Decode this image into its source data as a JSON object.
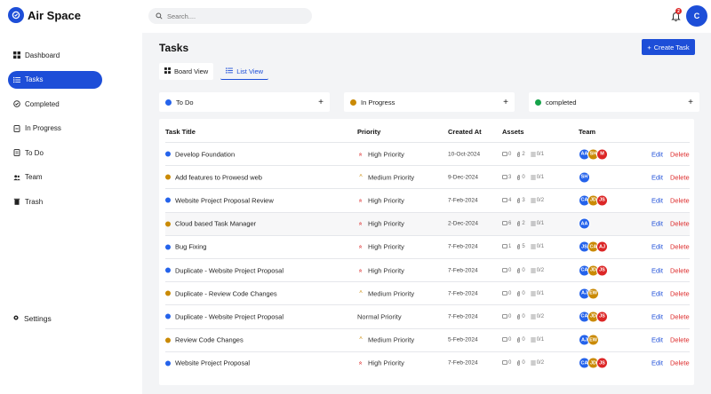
{
  "app": {
    "name": "Air Space"
  },
  "sidebar": {
    "items": [
      {
        "label": "Dashboard",
        "icon": "dashboard-icon",
        "active": false
      },
      {
        "label": "Tasks",
        "icon": "tasks-icon",
        "active": true
      },
      {
        "label": "Completed",
        "icon": "check-circle-icon",
        "active": false
      },
      {
        "label": "In Progress",
        "icon": "in-progress-icon",
        "active": false
      },
      {
        "label": "To Do",
        "icon": "todo-icon",
        "active": false
      },
      {
        "label": "Team",
        "icon": "team-icon",
        "active": false
      },
      {
        "label": "Trash",
        "icon": "trash-icon",
        "active": false
      }
    ],
    "settings_label": "Settings"
  },
  "topbar": {
    "search_placeholder": "Search....",
    "notification_count": "2",
    "user_initial": "C"
  },
  "main": {
    "title": "Tasks",
    "create_label": "Create Task",
    "views": [
      {
        "label": "Board View",
        "active": false
      },
      {
        "label": "List View",
        "active": true
      }
    ],
    "stages": [
      {
        "label": "To Do",
        "color": "#2563eb"
      },
      {
        "label": "In Progress",
        "color": "#ca8a04"
      },
      {
        "label": "completed",
        "color": "#16a34a"
      }
    ],
    "table": {
      "headers": {
        "title": "Task Title",
        "priority": "Priority",
        "created": "Created At",
        "assets": "Assets",
        "team": "Team"
      },
      "edit_label": "Edit",
      "delete_label": "Delete",
      "rows": [
        {
          "title": "Develop Foundation",
          "dot": "#2563eb",
          "priority": "High Priority",
          "level": "high",
          "created": "10-Oct-2024",
          "files": "0",
          "links": "2",
          "subtasks": "0/1",
          "team": [
            [
              "AA",
              "#2563eb"
            ],
            [
              "SH",
              "#ca8a04"
            ],
            [
              "M",
              "#dc2626"
            ]
          ]
        },
        {
          "title": "Add features to Prowesd web",
          "dot": "#ca8a04",
          "priority": "Medium Priority",
          "level": "medium",
          "created": "9-Dec-2024",
          "files": "3",
          "links": "0",
          "subtasks": "0/1",
          "team": [
            [
              "SH",
              "#2563eb"
            ]
          ]
        },
        {
          "title": "Website Project Proposal Review",
          "dot": "#2563eb",
          "priority": "High Priority",
          "level": "high",
          "created": "7-Feb-2024",
          "files": "4",
          "links": "3",
          "subtasks": "0/2",
          "team": [
            [
              "CA",
              "#2563eb"
            ],
            [
              "JD",
              "#ca8a04"
            ],
            [
              "JS",
              "#dc2626"
            ]
          ]
        },
        {
          "title": "Cloud based Task Manager",
          "dot": "#ca8a04",
          "priority": "High Priority",
          "level": "high",
          "created": "2-Dec-2024",
          "files": "6",
          "links": "2",
          "subtasks": "0/1",
          "team": [
            [
              "AA",
              "#2563eb"
            ]
          ]
        },
        {
          "title": "Bug Fixing",
          "dot": "#2563eb",
          "priority": "High Priority",
          "level": "high",
          "created": "7-Feb-2024",
          "files": "1",
          "links": "5",
          "subtasks": "0/1",
          "team": [
            [
              "JS",
              "#2563eb"
            ],
            [
              "CA",
              "#ca8a04"
            ],
            [
              "AJ",
              "#dc2626"
            ]
          ]
        },
        {
          "title": "Duplicate - Website Project Proposal",
          "dot": "#2563eb",
          "priority": "High Priority",
          "level": "high",
          "created": "7-Feb-2024",
          "files": "0",
          "links": "0",
          "subtasks": "0/2",
          "team": [
            [
              "CA",
              "#2563eb"
            ],
            [
              "JD",
              "#ca8a04"
            ],
            [
              "JS",
              "#dc2626"
            ]
          ]
        },
        {
          "title": "Duplicate - Review Code Changes",
          "dot": "#ca8a04",
          "priority": "Medium Priority",
          "level": "medium",
          "created": "7-Feb-2024",
          "files": "0",
          "links": "0",
          "subtasks": "0/1",
          "team": [
            [
              "AJ",
              "#2563eb"
            ],
            [
              "EW",
              "#ca8a04"
            ]
          ]
        },
        {
          "title": "Duplicate - Website Project Proposal",
          "dot": "#2563eb",
          "priority": "Normal Priority",
          "level": "normal",
          "created": "7-Feb-2024",
          "files": "0",
          "links": "0",
          "subtasks": "0/2",
          "team": [
            [
              "CA",
              "#2563eb"
            ],
            [
              "JD",
              "#ca8a04"
            ],
            [
              "JS",
              "#dc2626"
            ]
          ]
        },
        {
          "title": "Review Code Changes",
          "dot": "#ca8a04",
          "priority": "Medium Priority",
          "level": "medium",
          "created": "5-Feb-2024",
          "files": "0",
          "links": "0",
          "subtasks": "0/1",
          "team": [
            [
              "AJ",
              "#2563eb"
            ],
            [
              "EW",
              "#ca8a04"
            ]
          ]
        },
        {
          "title": "Website Project Proposal",
          "dot": "#2563eb",
          "priority": "High Priority",
          "level": "high",
          "created": "7-Feb-2024",
          "files": "0",
          "links": "0",
          "subtasks": "0/2",
          "team": [
            [
              "CA",
              "#2563eb"
            ],
            [
              "JD",
              "#ca8a04"
            ],
            [
              "JS",
              "#dc2626"
            ]
          ]
        }
      ]
    }
  }
}
